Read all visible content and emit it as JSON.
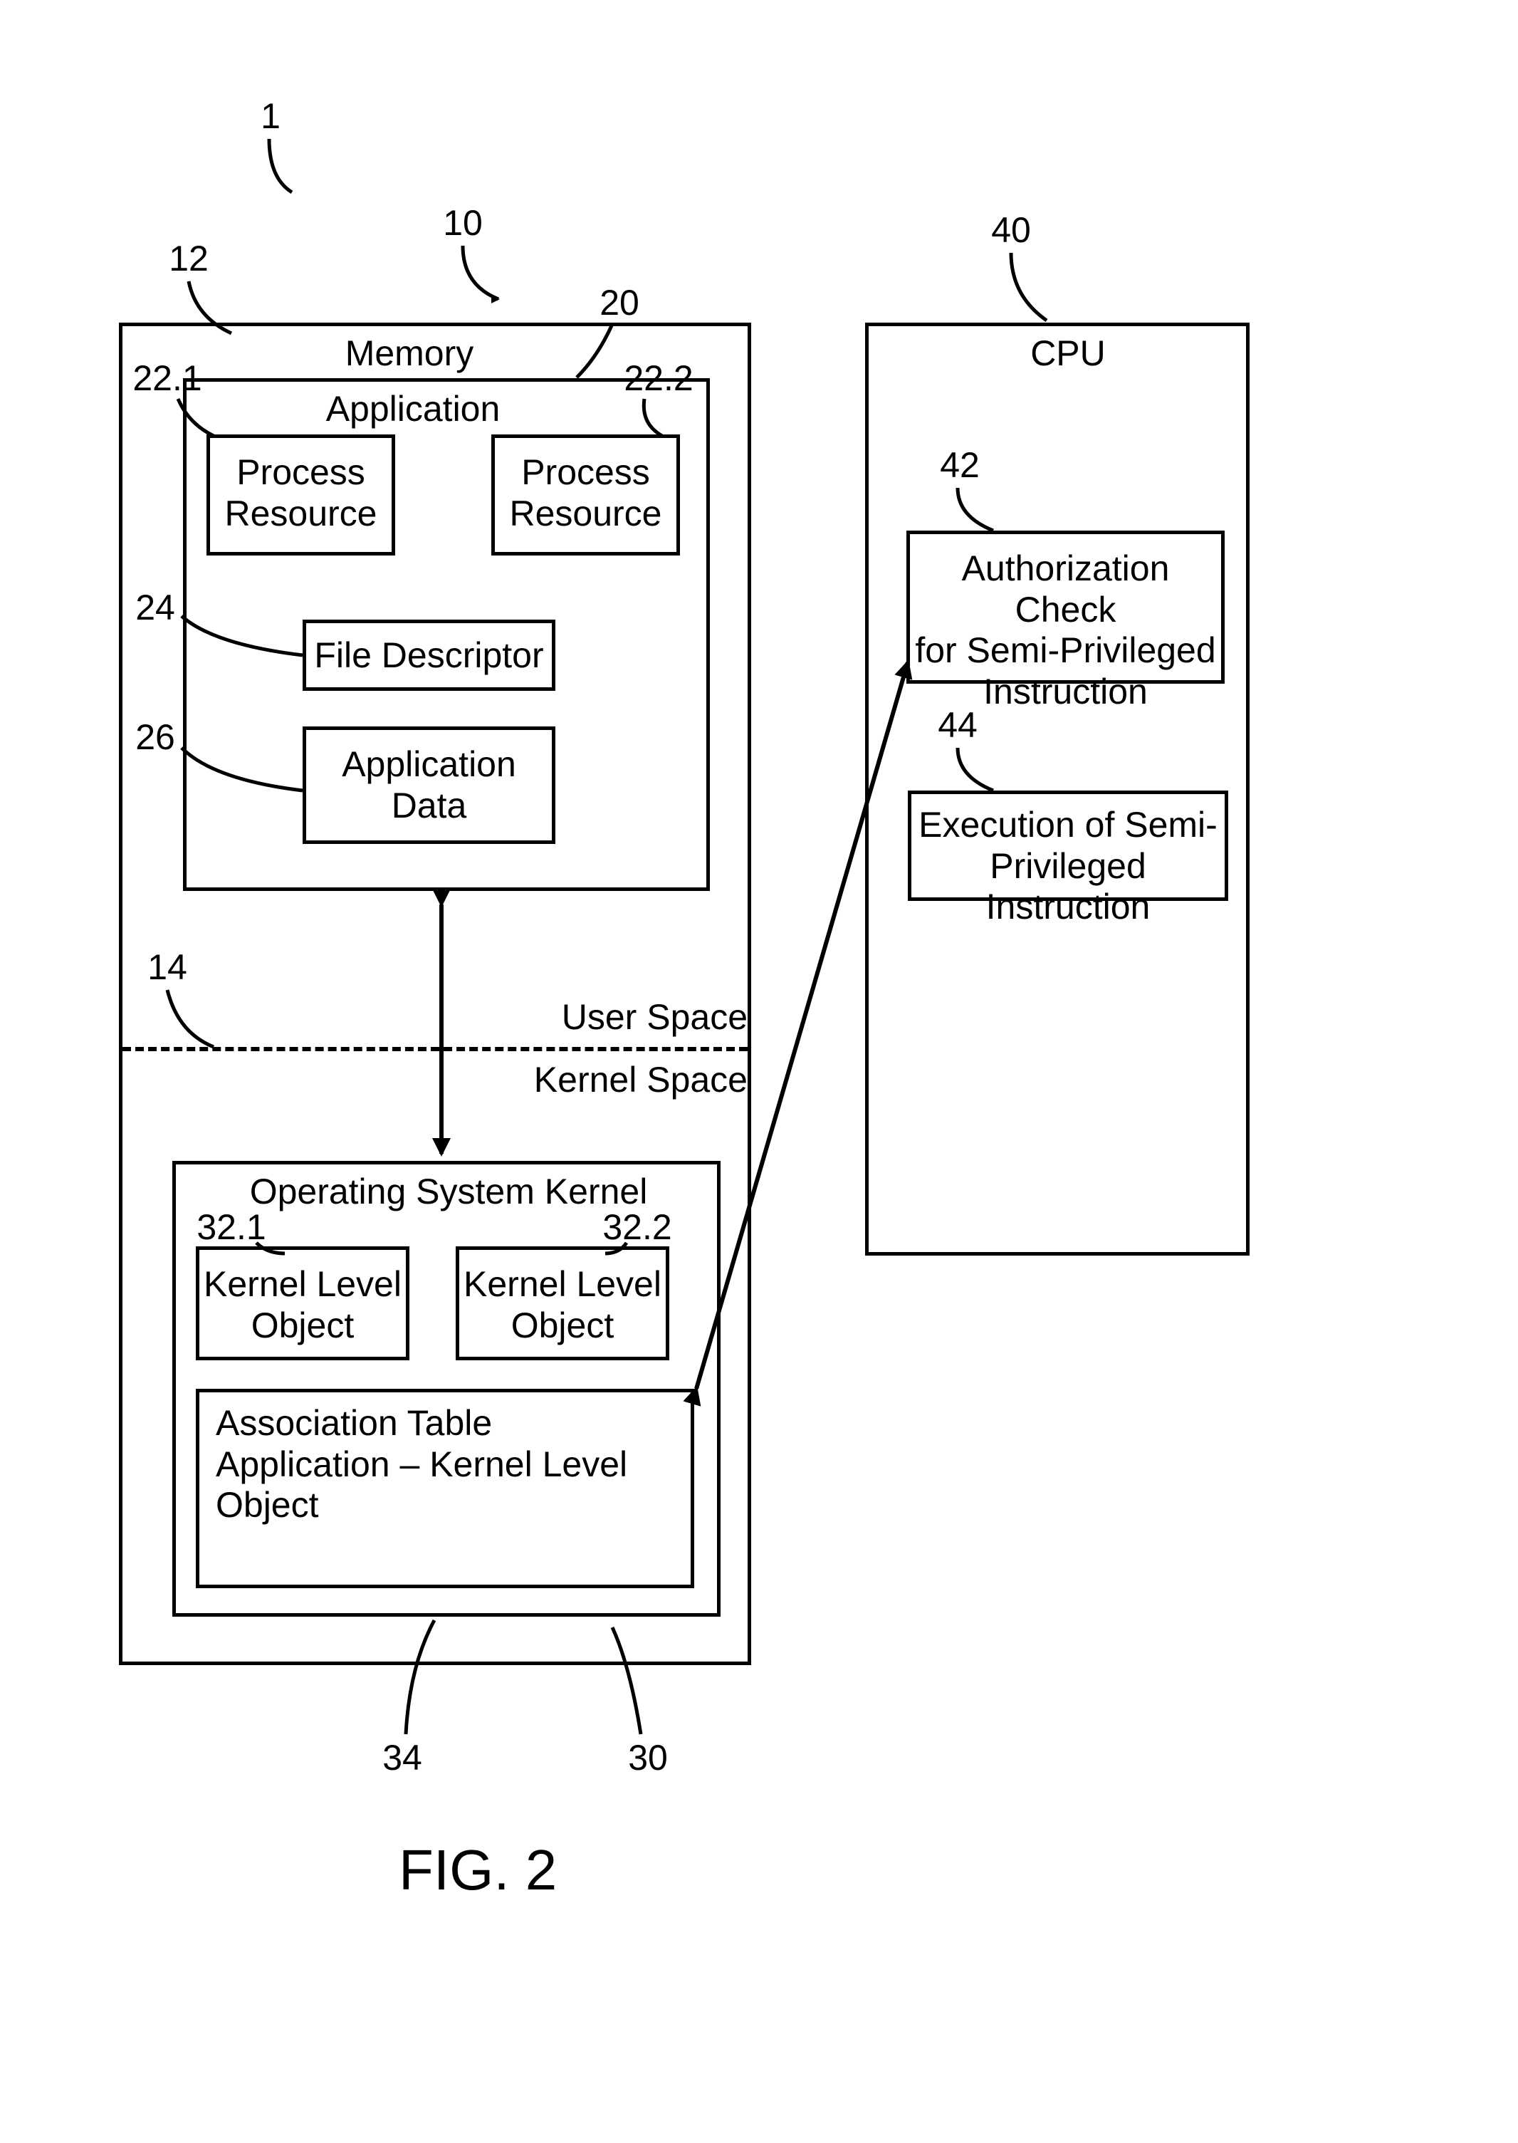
{
  "refs": {
    "r1": "1",
    "r10": "10",
    "r12": "12",
    "r14": "14",
    "r20": "20",
    "r22_1": "22.1",
    "r22_2": "22.2",
    "r24": "24",
    "r26": "26",
    "r30": "30",
    "r32_1": "32.1",
    "r32_2": "32.2",
    "r34": "34",
    "r40": "40",
    "r42": "42",
    "r44": "44"
  },
  "main": {
    "memory": "Memory",
    "application": "Application",
    "proc_res_1": "Process\nResource",
    "proc_res_2": "Process\nResource",
    "file_desc": "File Descriptor",
    "app_data": "Application\nData",
    "user_space": "User Space",
    "kernel_space": "Kernel Space",
    "os_kernel": "Operating System Kernel",
    "klo_1": "Kernel Level\nObject",
    "klo_2": "Kernel Level\nObject",
    "assoc_table": "Association Table\nApplication – Kernel Level Object"
  },
  "cpu": {
    "title": "CPU",
    "auth_check": "Authorization Check\nfor Semi-Privileged\nInstruction",
    "exec": "Execution of Semi-\nPrivileged Instruction"
  },
  "figure": "FIG. 2"
}
